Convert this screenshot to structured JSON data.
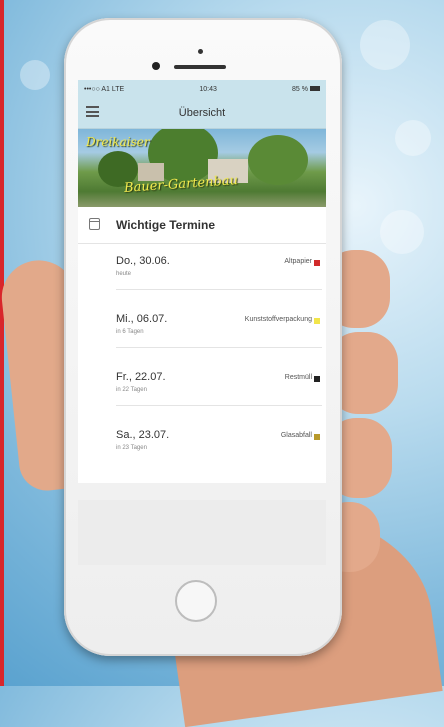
{
  "status_bar": {
    "carrier": "•••○○ A1 LTE",
    "time": "10:43",
    "battery": "85 %"
  },
  "nav": {
    "title": "Übersicht",
    "menu_icon": "menu-icon"
  },
  "banner": {
    "line1": "Dreikaiser",
    "line2": "Bauer-Gartenbau"
  },
  "section": {
    "icon": "calendar-icon",
    "title": "Wichtige Termine"
  },
  "appointments": [
    {
      "date": "Do., 30.06.",
      "relative": "heute",
      "type": "Altpapier",
      "color": "#d12a2a"
    },
    {
      "date": "Mi., 06.07.",
      "relative": "in 6 Tagen",
      "type": "Kunststoffverpackung",
      "color": "#f2e54b"
    },
    {
      "date": "Fr., 22.07.",
      "relative": "in 22 Tagen",
      "type": "Restmüll",
      "color": "#222222"
    },
    {
      "date": "Sa., 23.07.",
      "relative": "in 23 Tagen",
      "type": "Glasabfall",
      "color": "#b99a2b"
    }
  ]
}
